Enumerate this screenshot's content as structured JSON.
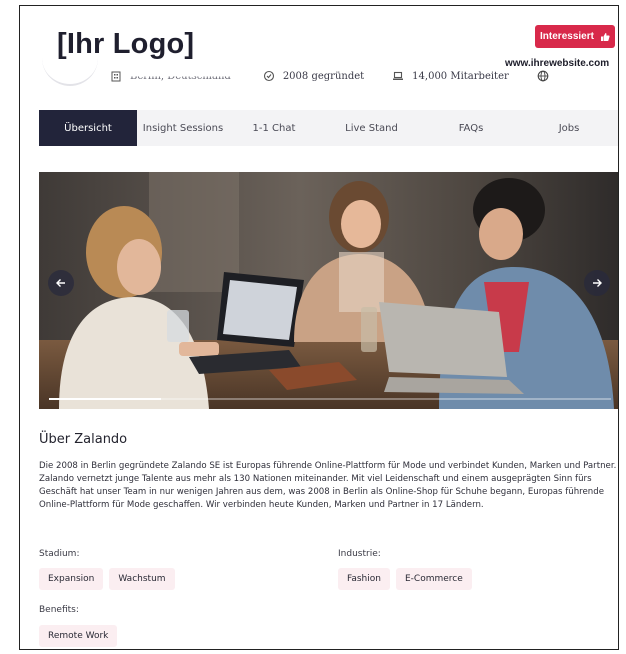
{
  "header": {
    "logo_text": "[Ihr Logo]",
    "location": "Berlin, Deutschland",
    "founded": "2008 gegründet",
    "employees": "14,000 Mitarbeiter",
    "website": "www.ihrewebsite.com",
    "interest_button": "Interessiert"
  },
  "tabs": [
    {
      "label": "Übersicht",
      "active": true
    },
    {
      "label": "Insight Sessions",
      "active": false
    },
    {
      "label": "1-1 Chat",
      "active": false
    },
    {
      "label": "Live Stand",
      "active": false
    },
    {
      "label": "FAQs",
      "active": false
    },
    {
      "label": "Jobs",
      "active": false
    }
  ],
  "carousel": {
    "progress": 0.2
  },
  "about": {
    "title": "Über Zalando",
    "text": "Die 2008 in Berlin gegründete Zalando SE ist Europas führende Online-Plattform für Mode und verbindet Kunden, Marken und Partner. Zalando vernetzt junge Talente aus mehr als 130 Nationen miteinander. Mit viel Leidenschaft und einem ausgeprägten Sinn fürs Geschäft hat unser Team in nur wenigen Jahren aus dem, was 2008 in Berlin als Online-Shop für Schuhe begann, Europas führende Online-Plattform für Mode geschaffen. Wir verbinden heute Kunden, Marken und Partner in 17 Ländern."
  },
  "stadium": {
    "label": "Stadium:",
    "chips": [
      "Expansion",
      "Wachstum"
    ]
  },
  "industrie": {
    "label": "Industrie:",
    "chips": [
      "Fashion",
      "E-Commerce"
    ]
  },
  "benefits": {
    "label": "Benefits:",
    "chips": [
      "Remote Work"
    ]
  },
  "colors": {
    "accent": "#d8294a",
    "tab_active": "#22243a",
    "chip_bg": "#fbeef1"
  }
}
